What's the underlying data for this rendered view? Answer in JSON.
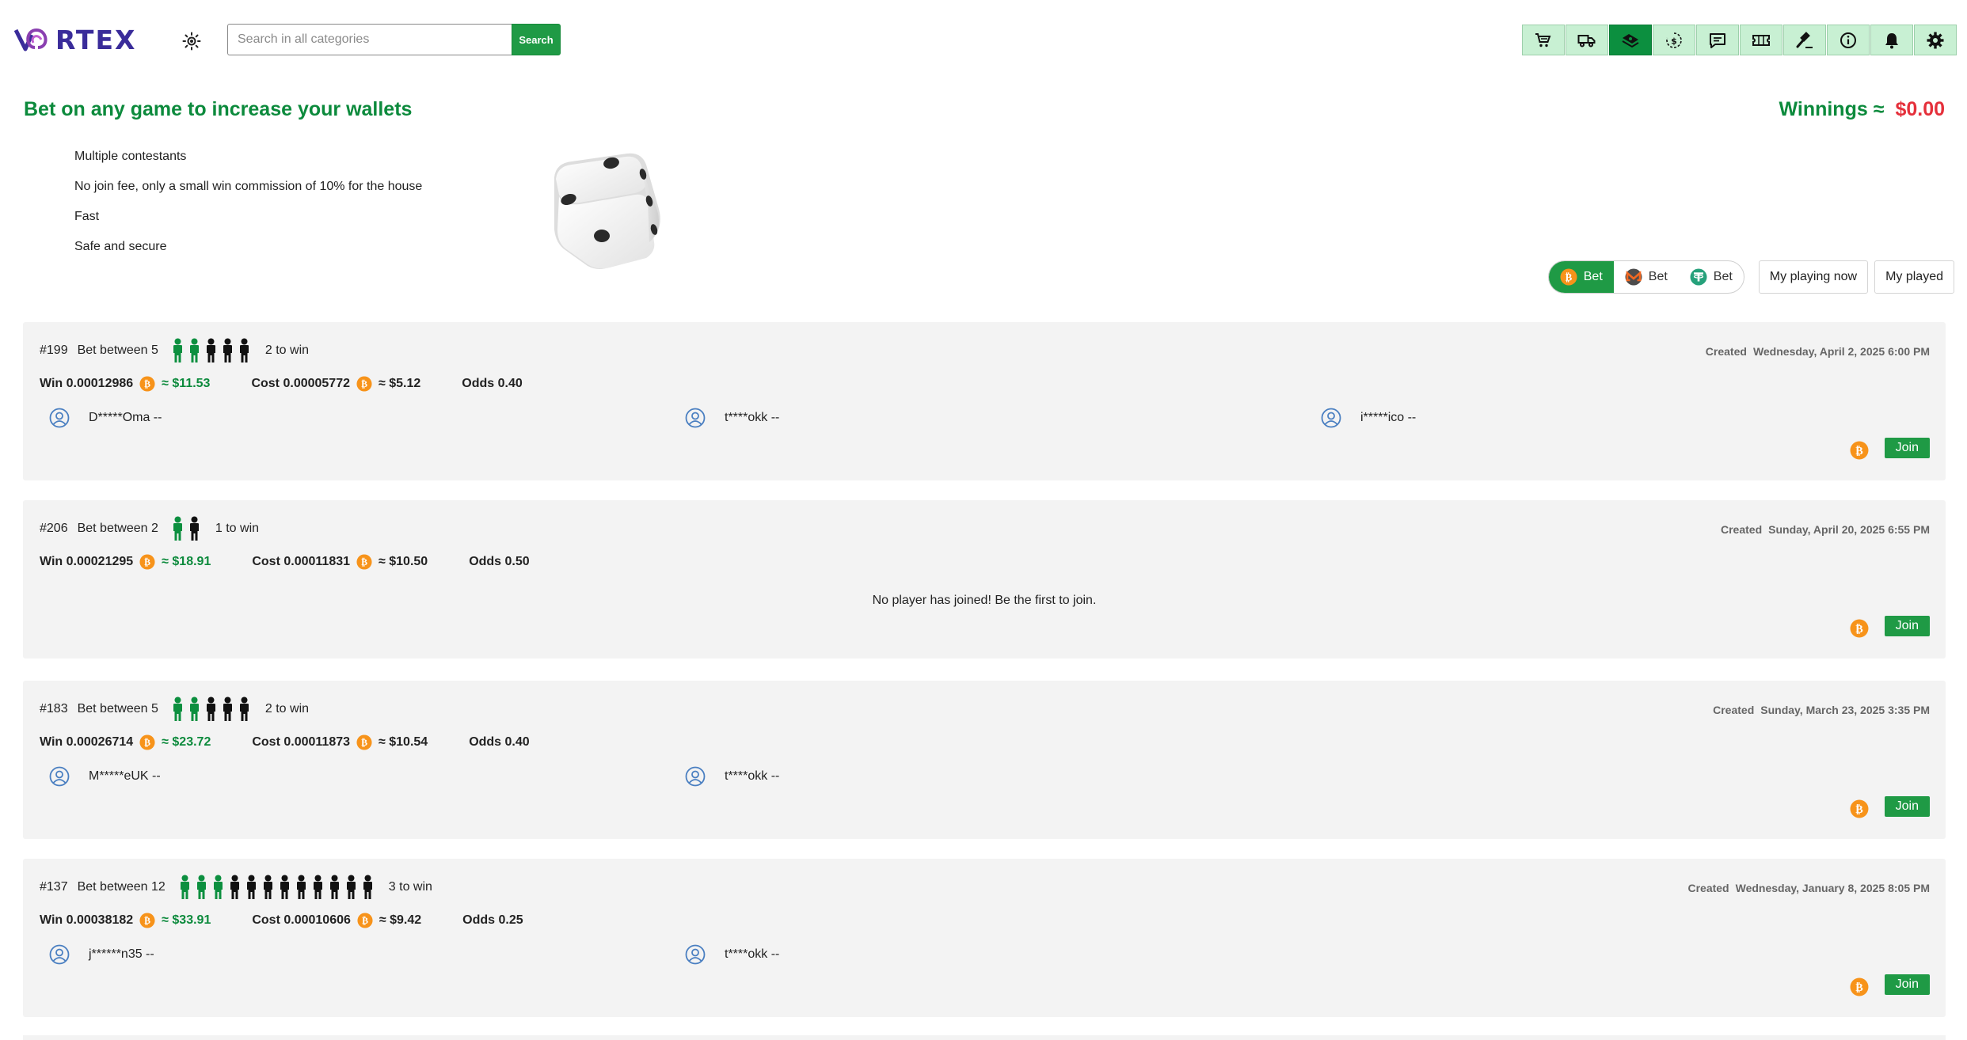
{
  "header": {
    "logo_text": "RTEX",
    "search_placeholder": "Search in all categories",
    "search_button": "Search",
    "icons": [
      "cart-icon",
      "truck-icon",
      "money-icon",
      "exchange-icon",
      "chat-icon",
      "ticket-icon",
      "gavel-icon",
      "info-icon",
      "bell-icon",
      "gear-icon"
    ],
    "active_icon": "money-icon",
    "accent_color": "#1f9a45"
  },
  "hero": {
    "title": "Bet on any game to increase your wallets",
    "winnings_label": "Winnings ≈",
    "winnings_amount": "$0.00",
    "features": [
      "Multiple contestants",
      "No join fee, only a small win commission of 10% for the house",
      "Fast",
      "Safe and secure"
    ]
  },
  "filters": {
    "coin_tabs": [
      {
        "coin": "bitcoin",
        "label": "Bet",
        "active": true
      },
      {
        "coin": "monero",
        "label": "Bet",
        "active": false
      },
      {
        "coin": "tether",
        "label": "Bet",
        "active": false
      }
    ],
    "my_playing_now": "My playing now",
    "my_played": "My played"
  },
  "games": [
    {
      "id": "#199",
      "bet_between": "Bet between 5",
      "total": 5,
      "winners": 2,
      "to_win": "2 to win",
      "created_label": "Created",
      "created": "Wednesday, April 2, 2025 6:00 PM",
      "win_label": "Win",
      "win_btc": "0.00012986",
      "win_usd": "≈ $11.53",
      "cost_label": "Cost",
      "cost_btc": "0.00005772",
      "cost_usd": "≈ $5.12",
      "odds": "Odds 0.40",
      "players": [
        "D*****Oma --",
        "t****okk --",
        "i*****ico --"
      ],
      "no_player_text": "",
      "join_label": "Join"
    },
    {
      "id": "#206",
      "bet_between": "Bet between 2",
      "total": 2,
      "winners": 1,
      "to_win": "1 to win",
      "created_label": "Created",
      "created": "Sunday, April 20, 2025 6:55 PM",
      "win_label": "Win",
      "win_btc": "0.00021295",
      "win_usd": "≈ $18.91",
      "cost_label": "Cost",
      "cost_btc": "0.00011831",
      "cost_usd": "≈ $10.50",
      "odds": "Odds 0.50",
      "players": [],
      "no_player_text": "No player has joined! Be the first to join.",
      "join_label": "Join"
    },
    {
      "id": "#183",
      "bet_between": "Bet between 5",
      "total": 5,
      "winners": 2,
      "to_win": "2 to win",
      "created_label": "Created",
      "created": "Sunday, March 23, 2025 3:35 PM",
      "win_label": "Win",
      "win_btc": "0.00026714",
      "win_usd": "≈ $23.72",
      "cost_label": "Cost",
      "cost_btc": "0.00011873",
      "cost_usd": "≈ $10.54",
      "odds": "Odds 0.40",
      "players": [
        "M*****eUK --",
        "t****okk --"
      ],
      "no_player_text": "",
      "join_label": "Join"
    },
    {
      "id": "#137",
      "bet_between": "Bet between 12",
      "total": 12,
      "winners": 3,
      "to_win": "3 to win",
      "created_label": "Created",
      "created": "Wednesday, January 8, 2025 8:05 PM",
      "win_label": "Win",
      "win_btc": "0.00038182",
      "win_usd": "≈ $33.91",
      "cost_label": "Cost",
      "cost_btc": "0.00010606",
      "cost_usd": "≈ $9.42",
      "odds": "Odds 0.25",
      "players": [
        "j******n35 --",
        "t****okk --"
      ],
      "no_player_text": "",
      "join_label": "Join"
    }
  ]
}
